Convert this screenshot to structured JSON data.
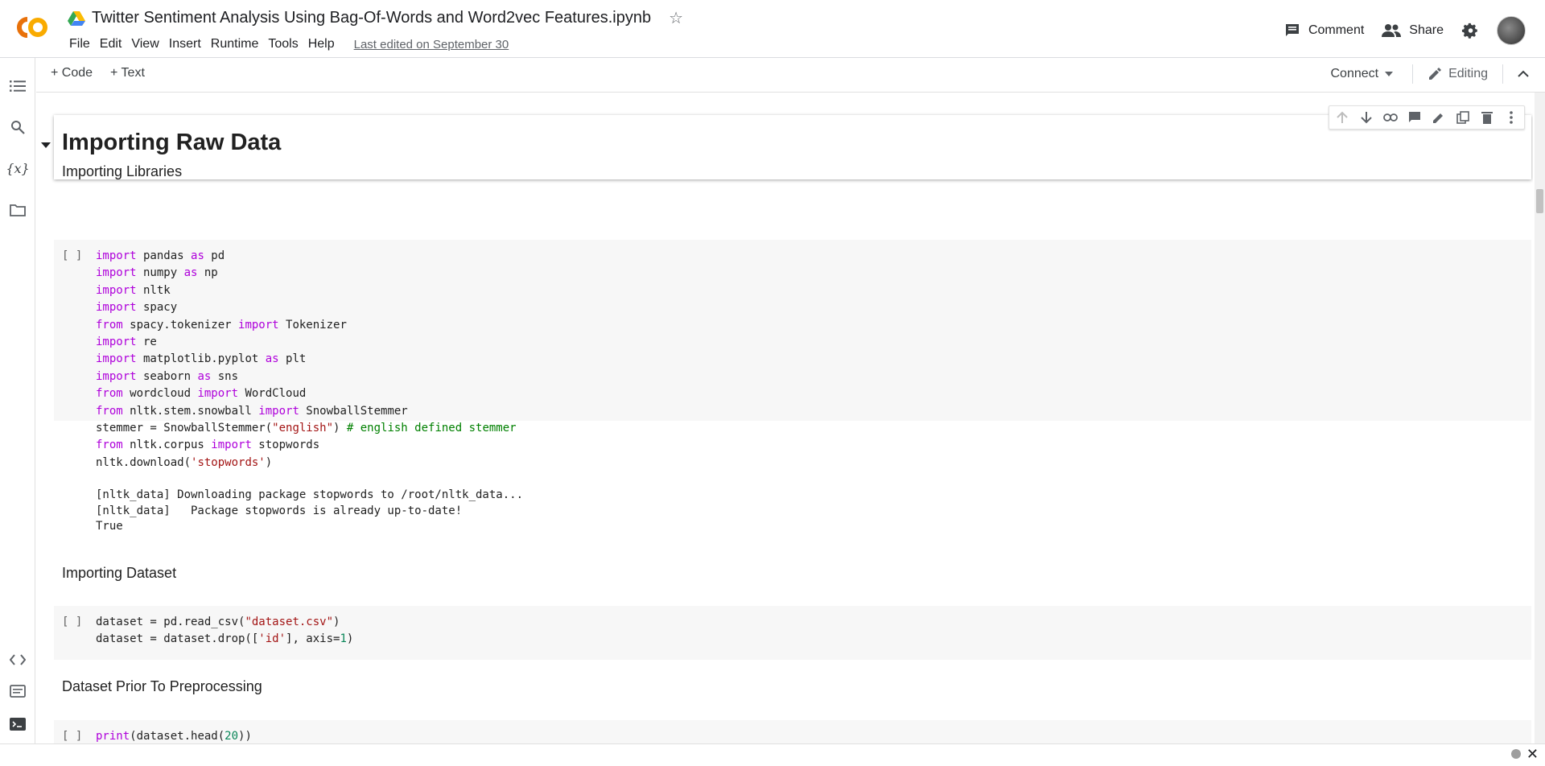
{
  "app": {
    "logo_text": "CO",
    "notebook_title": "Twitter Sentiment Analysis Using Bag-Of-Words and Word2vec Features.ipynb",
    "menu": [
      "File",
      "Edit",
      "View",
      "Insert",
      "Runtime",
      "Tools",
      "Help"
    ],
    "last_edited": "Last edited on September 30",
    "comment_label": "Comment",
    "share_label": "Share"
  },
  "toolbar": {
    "add_code": "+ Code",
    "add_text": "+ Text",
    "connect": "Connect",
    "editing": "Editing"
  },
  "cells": {
    "heading": "Importing Raw Data",
    "importing_libraries": "Importing Libraries",
    "importing_dataset": "Importing Dataset",
    "prior_preprocessing": "Dataset Prior To Preprocessing",
    "run_indicator": "[ ]",
    "output_lines": [
      "[nltk_data] Downloading package stopwords to /root/nltk_data...",
      "[nltk_data]   Package stopwords is already up-to-date!",
      "True"
    ]
  },
  "colors": {
    "keyword": "#af00db",
    "string": "#a31515",
    "comment": "#008000",
    "number": "#098658",
    "logo_orange": "#f9ab00"
  }
}
